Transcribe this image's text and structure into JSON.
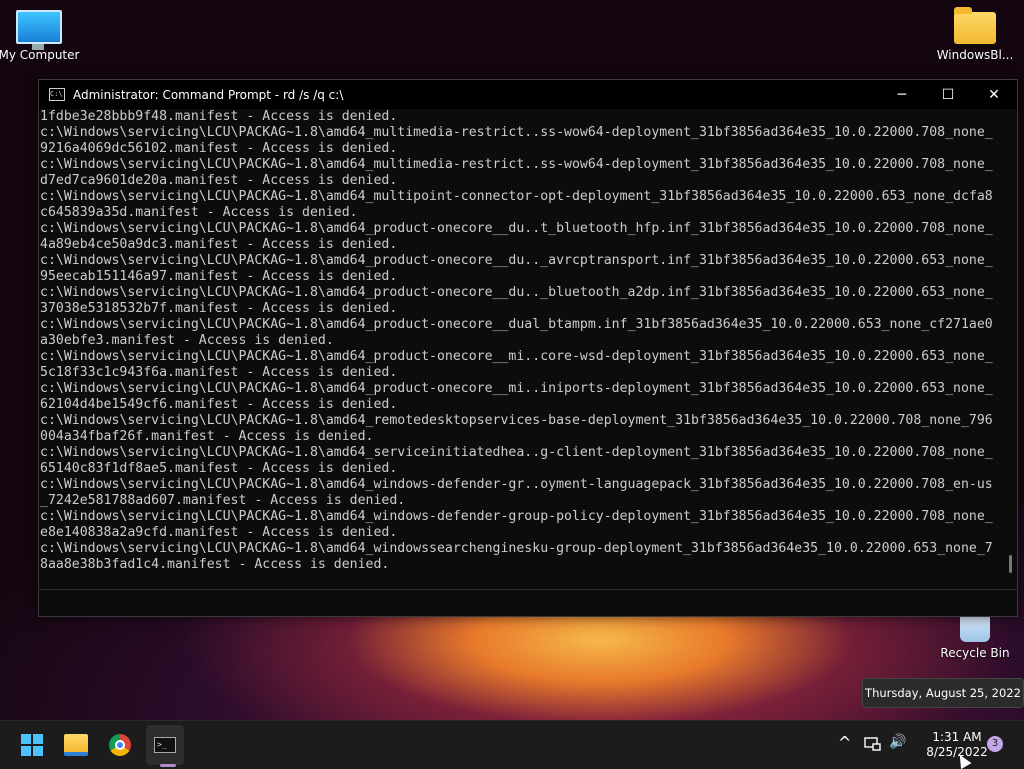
{
  "desktop": {
    "icons": [
      {
        "label": "My Computer"
      },
      {
        "label": "WindowsBl..."
      },
      {
        "label": "Recycle Bin"
      }
    ]
  },
  "window": {
    "title": "Administrator: Command Prompt - rd  /s /q c:\\",
    "controls": {
      "minimize": "─",
      "maximize": "☐",
      "close": "✕"
    },
    "lines": [
      "1fdbe3e28bbb9f48.manifest - Access is denied.",
      "c:\\Windows\\servicing\\LCU\\PACKAG~1.8\\amd64_multimedia-restrict..ss-wow64-deployment_31bf3856ad364e35_10.0.22000.708_none_",
      "9216a4069dc56102.manifest - Access is denied.",
      "c:\\Windows\\servicing\\LCU\\PACKAG~1.8\\amd64_multimedia-restrict..ss-wow64-deployment_31bf3856ad364e35_10.0.22000.708_none_",
      "d7ed7ca9601de20a.manifest - Access is denied.",
      "c:\\Windows\\servicing\\LCU\\PACKAG~1.8\\amd64_multipoint-connector-opt-deployment_31bf3856ad364e35_10.0.22000.653_none_dcfa8",
      "c645839a35d.manifest - Access is denied.",
      "c:\\Windows\\servicing\\LCU\\PACKAG~1.8\\amd64_product-onecore__du..t_bluetooth_hfp.inf_31bf3856ad364e35_10.0.22000.708_none_",
      "4a89eb4ce50a9dc3.manifest - Access is denied.",
      "c:\\Windows\\servicing\\LCU\\PACKAG~1.8\\amd64_product-onecore__du.._avrcptransport.inf_31bf3856ad364e35_10.0.22000.653_none_",
      "95eecab151146a97.manifest - Access is denied.",
      "c:\\Windows\\servicing\\LCU\\PACKAG~1.8\\amd64_product-onecore__du.._bluetooth_a2dp.inf_31bf3856ad364e35_10.0.22000.653_none_",
      "37038e5318532b7f.manifest - Access is denied.",
      "c:\\Windows\\servicing\\LCU\\PACKAG~1.8\\amd64_product-onecore__dual_btampm.inf_31bf3856ad364e35_10.0.22000.653_none_cf271ae0",
      "a30ebfe3.manifest - Access is denied.",
      "c:\\Windows\\servicing\\LCU\\PACKAG~1.8\\amd64_product-onecore__mi..core-wsd-deployment_31bf3856ad364e35_10.0.22000.653_none_",
      "5c18f33c1c943f6a.manifest - Access is denied.",
      "c:\\Windows\\servicing\\LCU\\PACKAG~1.8\\amd64_product-onecore__mi..iniports-deployment_31bf3856ad364e35_10.0.22000.653_none_",
      "62104d4be1549cf6.manifest - Access is denied.",
      "c:\\Windows\\servicing\\LCU\\PACKAG~1.8\\amd64_remotedesktopservices-base-deployment_31bf3856ad364e35_10.0.22000.708_none_796",
      "004a34fbaf26f.manifest - Access is denied.",
      "c:\\Windows\\servicing\\LCU\\PACKAG~1.8\\amd64_serviceinitiatedhea..g-client-deployment_31bf3856ad364e35_10.0.22000.708_none_",
      "65140c83f1df8ae5.manifest - Access is denied.",
      "c:\\Windows\\servicing\\LCU\\PACKAG~1.8\\amd64_windows-defender-gr..oyment-languagepack_31bf3856ad364e35_10.0.22000.708_en-us",
      "_7242e581788ad607.manifest - Access is denied.",
      "c:\\Windows\\servicing\\LCU\\PACKAG~1.8\\amd64_windows-defender-group-policy-deployment_31bf3856ad364e35_10.0.22000.708_none_",
      "e8e140838a2a9cfd.manifest - Access is denied.",
      "c:\\Windows\\servicing\\LCU\\PACKAG~1.8\\amd64_windowssearchenginesku-group-deployment_31bf3856ad364e35_10.0.22000.653_none_7",
      "8aa8e38b3fad1c4.manifest - Access is denied."
    ]
  },
  "tooltip": {
    "text": "Thursday, August 25, 2022"
  },
  "taskbar": {
    "clock": {
      "time": "1:31 AM",
      "date": "8/25/2022"
    },
    "notification_count": "3",
    "tray_chevron": "^",
    "volume_icon": "🔊"
  },
  "colors": {
    "console_text": "#cccccc",
    "console_bg": "#0c0c0c",
    "taskbar_bg": "#1c1c1c",
    "start_blue": "#4cc2ff"
  }
}
